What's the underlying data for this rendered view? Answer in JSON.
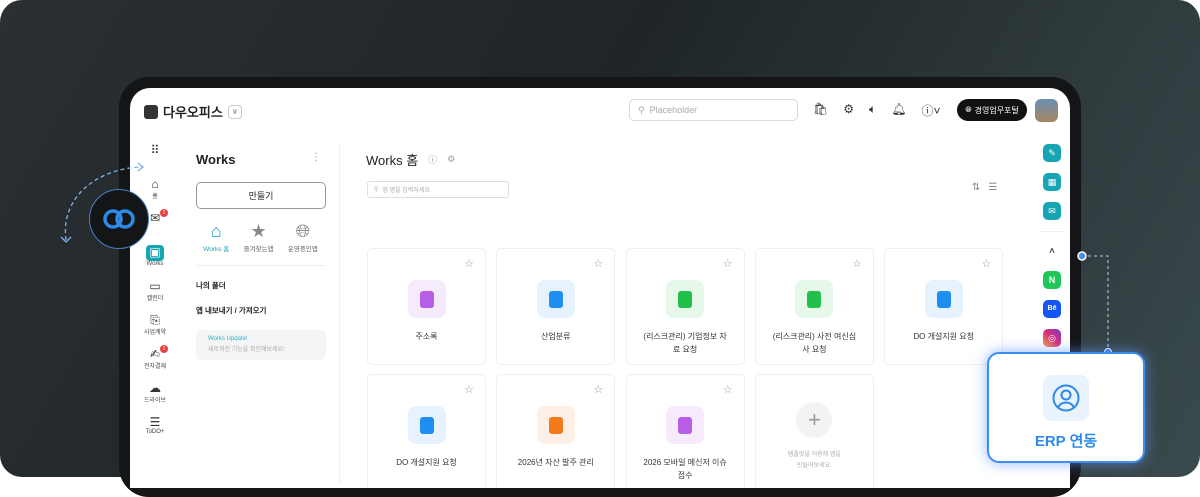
{
  "header": {
    "brand": "다우오피스",
    "search_placeholder": "Placeholder",
    "portal_label": "경영업무포털"
  },
  "rail": [
    {
      "label": "홈",
      "icon": "home-icon"
    },
    {
      "label": "",
      "icon": "mail-icon",
      "badge": "1"
    },
    {
      "label": "Works",
      "icon": "works-icon",
      "active": true
    },
    {
      "label": "캘린더",
      "icon": "calendar-icon"
    },
    {
      "label": "사업계약",
      "icon": "contract-icon"
    },
    {
      "label": "전자결재",
      "icon": "approval-icon",
      "badge": "1"
    },
    {
      "label": "드라이브",
      "icon": "cloud-icon"
    },
    {
      "label": "ToDO+",
      "icon": "todo-icon"
    }
  ],
  "sidebar": {
    "title": "Works",
    "create_label": "만들기",
    "tabs": [
      {
        "label": "Works 홈"
      },
      {
        "label": "즐겨찾는앱"
      },
      {
        "label": "운영중인앱"
      }
    ],
    "my_folder": "나의 폴더",
    "export_import": "앱 내보내기 / 가져오기",
    "update_title": "Works Update!",
    "update_desc": "새로워진 기능을 확인해보세요!"
  },
  "main": {
    "title": "Works 홈",
    "search_placeholder": "앱 명을 입력하세요.",
    "apps": [
      {
        "name": "주소록",
        "color": "#b65ee8",
        "bg": "#f6eafd"
      },
      {
        "name": "산업분류",
        "color": "#1e8ef0",
        "bg": "#e6f3fe"
      },
      {
        "name": "(리스크관리) 기업정보 자료 요청",
        "color": "#20c04a",
        "bg": "#e6f8ea"
      },
      {
        "name": "(리스크관리) 사전 여신심사 요청",
        "color": "#20c04a",
        "bg": "#e6f8ea"
      },
      {
        "name": "DO 개설지원 요청",
        "color": "#1e8ef0",
        "bg": "#e6f3fe"
      },
      {
        "name": "DO 개설지원 요청",
        "color": "#1e8ef0",
        "bg": "#e6f3fe"
      },
      {
        "name": "2026년 자산 발주 관리",
        "color": "#f27a1a",
        "bg": "#fef0e6"
      },
      {
        "name": "2026 모바일 메신저 이슈 접수",
        "color": "#b65ee8",
        "bg": "#f6eafd"
      }
    ],
    "template_hint": "템플릿을 이용해 앱을 만들어보세요."
  },
  "right_rail": {
    "accent": "#17a5b3"
  },
  "callout": {
    "label": "ERP 연동",
    "accent": "#2d8ae8"
  }
}
